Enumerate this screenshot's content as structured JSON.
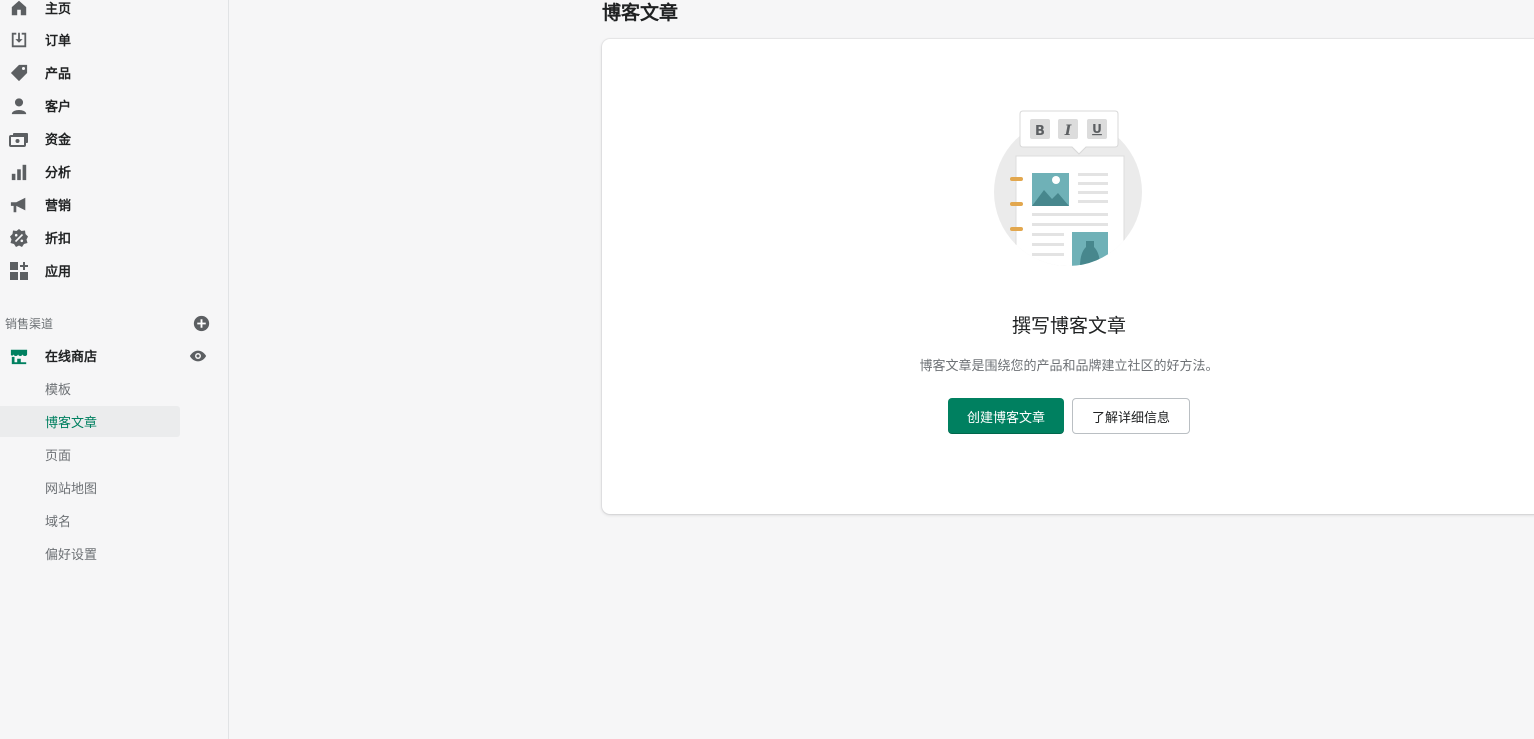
{
  "sidebar": {
    "items": [
      {
        "label": "主页",
        "icon": "home-icon"
      },
      {
        "label": "订单",
        "icon": "orders-icon"
      },
      {
        "label": "产品",
        "icon": "tag-icon"
      },
      {
        "label": "客户",
        "icon": "person-icon"
      },
      {
        "label": "资金",
        "icon": "finance-icon"
      },
      {
        "label": "分析",
        "icon": "bar-chart-icon"
      },
      {
        "label": "营销",
        "icon": "megaphone-icon"
      },
      {
        "label": "折扣",
        "icon": "discount-icon"
      },
      {
        "label": "应用",
        "icon": "apps-icon"
      }
    ],
    "sales_channels": {
      "label": "销售渠道",
      "add_icon": "plus-circle-icon",
      "online_store": {
        "label": "在线商店",
        "icon": "store-icon",
        "view_icon": "eye-icon"
      },
      "sub_items": [
        {
          "label": "模板",
          "active": false
        },
        {
          "label": "博客文章",
          "active": true
        },
        {
          "label": "页面",
          "active": false
        },
        {
          "label": "网站地图",
          "active": false
        },
        {
          "label": "域名",
          "active": false
        },
        {
          "label": "偏好设置",
          "active": false
        }
      ]
    }
  },
  "main": {
    "title": "博客文章",
    "empty_state": {
      "heading": "撰写博客文章",
      "text": "博客文章是围绕您的产品和品牌建立社区的好方法。",
      "primary_button": "创建博客文章",
      "secondary_button": "了解详细信息",
      "toolbar_letters": [
        "B",
        "I",
        "U"
      ]
    }
  },
  "colors": {
    "accent": "#008060",
    "background": "#f6f6f7",
    "card": "#ffffff"
  }
}
